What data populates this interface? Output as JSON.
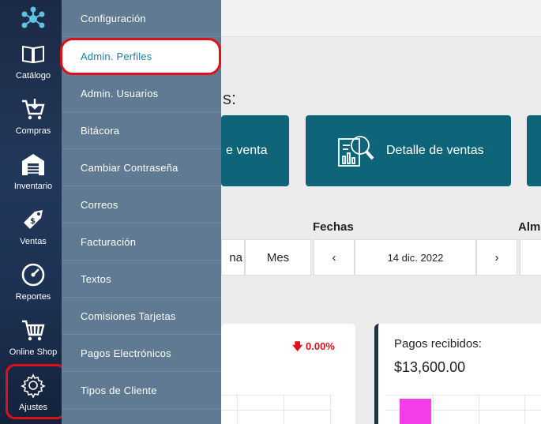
{
  "rail": {
    "items": [
      {
        "label": "",
        "icon": "network-hub-icon"
      },
      {
        "label": "Catálogo",
        "icon": "book-icon"
      },
      {
        "label": "Compras",
        "icon": "cart-download-icon"
      },
      {
        "label": "Inventario",
        "icon": "warehouse-icon"
      },
      {
        "label": "Ventas",
        "icon": "price-tag-icon"
      },
      {
        "label": "Reportes",
        "icon": "gauge-icon"
      },
      {
        "label": "Online Shop",
        "icon": "shopping-cart-icon"
      },
      {
        "label": "Ajustes",
        "icon": "gear-icon"
      }
    ]
  },
  "submenu": {
    "items": [
      "Configuración",
      "Admin. Perfiles",
      "Admin. Usuarios",
      "Bitácora",
      "Cambiar Contraseña",
      "Correos",
      "Facturación",
      "Textos",
      "Comisiones Tarjetas",
      "Pagos Electrónicos",
      "Tipos de Cliente"
    ],
    "active_index": 1
  },
  "main": {
    "section_colon": "s:",
    "tiles": {
      "first_label": "e venta",
      "second_label": "Detalle de ventas"
    },
    "fechas_label": "Fechas",
    "alm_label": "Alm",
    "range_buttons": [
      "na",
      "Mes"
    ],
    "date_nav": {
      "prev": "‹",
      "date": "14 dic. 2022",
      "next": "›"
    },
    "card1": {
      "change": "0.00%"
    },
    "card2": {
      "title": "Pagos recibidos:",
      "amount": "$13,600.00"
    }
  },
  "colors": {
    "accent": "#0e6478",
    "submenu_bg": "#5f7a92",
    "highlight": "#e0101a",
    "bar": "#f23ee8"
  }
}
